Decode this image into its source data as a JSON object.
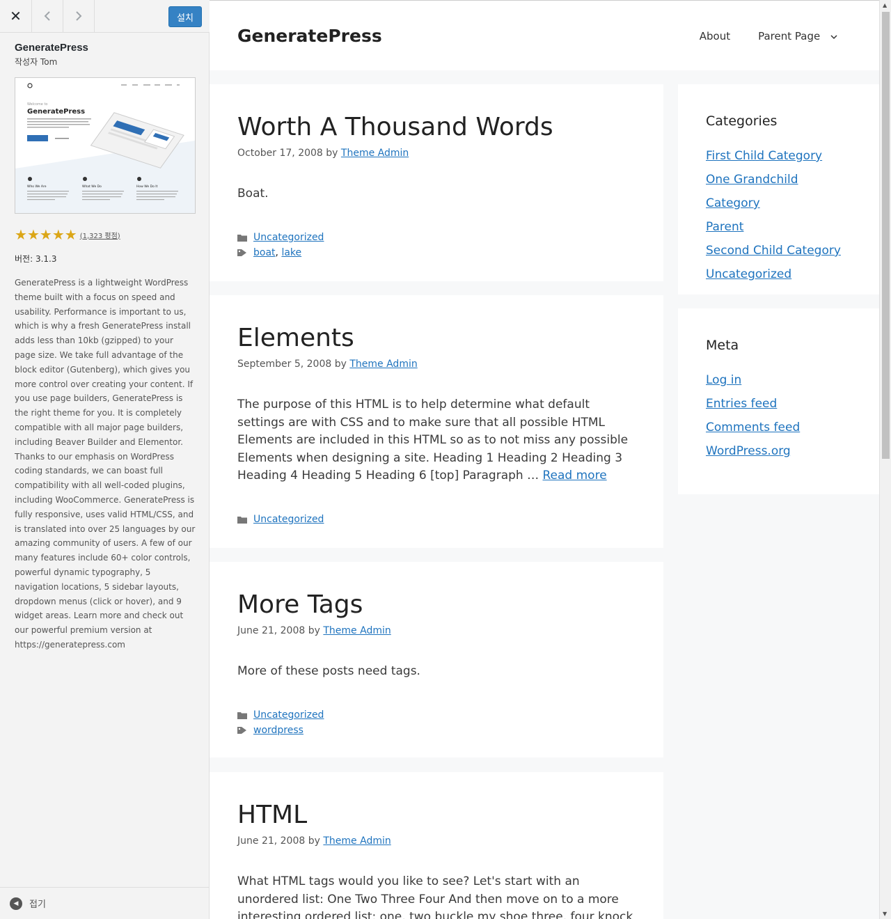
{
  "panel": {
    "close_label": "✕",
    "prev_label": "‹",
    "next_label": "›",
    "install_label": "설치",
    "theme_name": "GeneratePress",
    "author": "작성자 Tom",
    "rating_count": "(1,323 평점)",
    "rating_stars": 5,
    "version": "버전: 3.1.3",
    "description": "GeneratePress is a lightweight WordPress theme built with a focus on speed and usability. Performance is important to us, which is why a fresh GeneratePress install adds less than 10kb (gzipped) to your page size. We take full advantage of the block editor (Gutenberg), which gives you more control over creating your content. If you use page builders, GeneratePress is the right theme for you. It is completely compatible with all major page builders, including Beaver Builder and Elementor. Thanks to our emphasis on WordPress coding standards, we can boast full compatibility with all well-coded plugins, including WooCommerce. GeneratePress is fully responsive, uses valid HTML/CSS, and is translated into over 25 languages by our amazing community of users. A few of our many features include 60+ color controls, powerful dynamic typography, 5 navigation locations, 5 sidebar layouts, dropdown menus (click or hover), and 9 widget areas. Learn more and check out our powerful premium version at https://generatepress.com",
    "collapse_label": "접기",
    "screenshot": {
      "welcome": "Welcome to",
      "title": "GeneratePress",
      "f1": "Who We Are",
      "f2": "What We Do",
      "f3": "How We Do It"
    }
  },
  "site": {
    "title": "GeneratePress",
    "nav": [
      "About",
      "Parent Page"
    ],
    "posts": [
      {
        "title": "Worth A Thousand Words",
        "date": "October 17, 2008",
        "by": "by",
        "author": "Theme Admin",
        "content": "Boat.",
        "category": "Uncategorized",
        "tags": [
          "boat",
          "lake"
        ]
      },
      {
        "title": "Elements",
        "date": "September 5, 2008",
        "by": "by",
        "author": "Theme Admin",
        "content": "The purpose of this HTML is to help determine what default settings are with CSS and to make sure that all possible HTML Elements are included in this HTML so as to not miss any possible Elements when designing a site. Heading 1 Heading 2 Heading 3 Heading 4 Heading 5 Heading 6 [top] Paragraph …",
        "read_more": "Read more",
        "category": "Uncategorized"
      },
      {
        "title": "More Tags",
        "date": "June 21, 2008",
        "by": "by",
        "author": "Theme Admin",
        "content": "More of these posts need tags.",
        "category": "Uncategorized",
        "tags": [
          "wordpress"
        ]
      },
      {
        "title": "HTML",
        "date": "June 21, 2008",
        "by": "by",
        "author": "Theme Admin",
        "content": "What HTML tags would you like to see? Let's start with an unordered list: One Two Three Four And then move on to a more interesting ordered list: one, two buckle my shoe three, four knock at the door Five, six pick"
      }
    ],
    "widgets": {
      "categories": {
        "title": "Categories",
        "items": [
          "First Child Category",
          "One Grandchild Category",
          "Parent",
          "Second Child Category",
          "Uncategorized"
        ]
      },
      "meta": {
        "title": "Meta",
        "items": [
          "Log in",
          "Entries feed",
          "Comments feed",
          "WordPress.org"
        ]
      }
    }
  },
  "colors": {
    "link": "#1e73be",
    "install_button": "#3582c4",
    "star": "#dba617"
  }
}
